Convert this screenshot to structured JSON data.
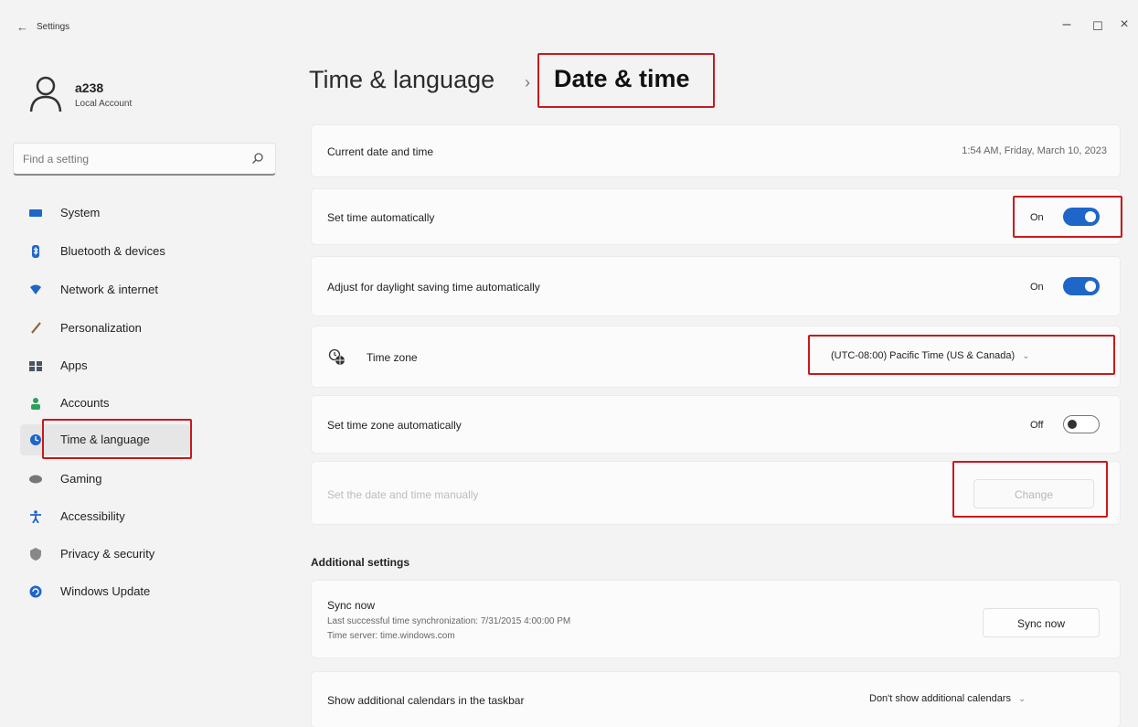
{
  "window": {
    "title": "Settings",
    "back_glyph": "←",
    "minimize_glyph": "–",
    "maximize_glyph": "☐",
    "close_glyph": "×"
  },
  "account": {
    "name": "a238",
    "type": "Local Account"
  },
  "search": {
    "placeholder": "Find a setting"
  },
  "sidebar": {
    "items": [
      {
        "label": "System",
        "icon": "system-icon",
        "color": "#1e66c8"
      },
      {
        "label": "Bluetooth & devices",
        "icon": "bluetooth-icon",
        "color": "#1e66c8"
      },
      {
        "label": "Network & internet",
        "icon": "network-icon",
        "color": "#1e66c8"
      },
      {
        "label": "Personalization",
        "icon": "brush-icon",
        "color": "#8a6d3b"
      },
      {
        "label": "Apps",
        "icon": "apps-icon",
        "color": "#4a5568"
      },
      {
        "label": "Accounts",
        "icon": "accounts-icon",
        "color": "#2e9e5b"
      },
      {
        "label": "Time & language",
        "icon": "globe-clock-icon",
        "color": "#1e66c8"
      },
      {
        "label": "Gaming",
        "icon": "gamepad-icon",
        "color": "#777777"
      },
      {
        "label": "Accessibility",
        "icon": "accessibility-icon",
        "color": "#1e66c8"
      },
      {
        "label": "Privacy & security",
        "icon": "shield-icon",
        "color": "#888888"
      },
      {
        "label": "Windows Update",
        "icon": "update-icon",
        "color": "#1e66c8"
      }
    ],
    "selected": "Time & language"
  },
  "header": {
    "parent": "Time & language",
    "separator": "›",
    "current": "Date & time"
  },
  "settings": {
    "current_date_time": {
      "label": "Current date and time",
      "value": "1:54 AM, Friday, March 10, 2023"
    },
    "set_time_auto": {
      "label": "Set time automatically",
      "state": "On"
    },
    "daylight_saving": {
      "label": "Adjust for daylight saving time automatically",
      "state": "On"
    },
    "time_zone": {
      "label": "Time zone",
      "value": "(UTC-08:00) Pacific Time (US & Canada)",
      "chevron": "⌄"
    },
    "set_time_zone_auto": {
      "label": "Set time zone automatically",
      "state": "Off"
    },
    "manual": {
      "label": "Set the date and time manually",
      "button": "Change"
    }
  },
  "additional": {
    "title": "Additional settings",
    "sync": {
      "label": "Sync now",
      "last_sync": "Last successful time synchronization: 7/31/2015 4:00:00 PM",
      "server": "Time server: time.windows.com",
      "button": "Sync now"
    },
    "calendars": {
      "label": "Show additional calendars in the taskbar",
      "value": "Don't show additional calendars",
      "chevron": "⌄"
    }
  },
  "colors": {
    "accent": "#1e66c8",
    "highlight": "#c8191e"
  }
}
